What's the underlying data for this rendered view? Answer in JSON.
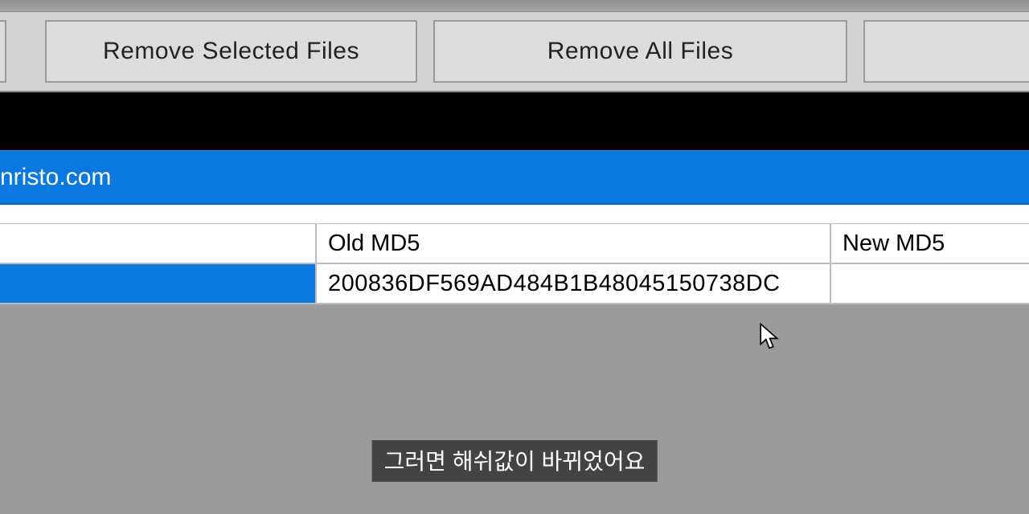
{
  "toolbar": {
    "remove_selected_label": "Remove Selected Files",
    "remove_all_label": "Remove All Files"
  },
  "selected_file": {
    "visible_name_fragment": "nristo.com"
  },
  "table": {
    "headers": {
      "filepath": "",
      "old_md5": "Old MD5",
      "new_md5": "New MD5"
    },
    "rows": [
      {
        "filepath_fragment": "",
        "old_md5": "200836DF569AD484B1B48045150738DC",
        "new_md5": ""
      }
    ]
  },
  "subtitle": "그러면 해쉬값이 바뀌었어요",
  "colors": {
    "selection_blue": "#0b78e0",
    "toolbar_bg": "#d3d3d3",
    "button_border": "#9a9a9a",
    "body_gray": "#9b9b9b"
  }
}
